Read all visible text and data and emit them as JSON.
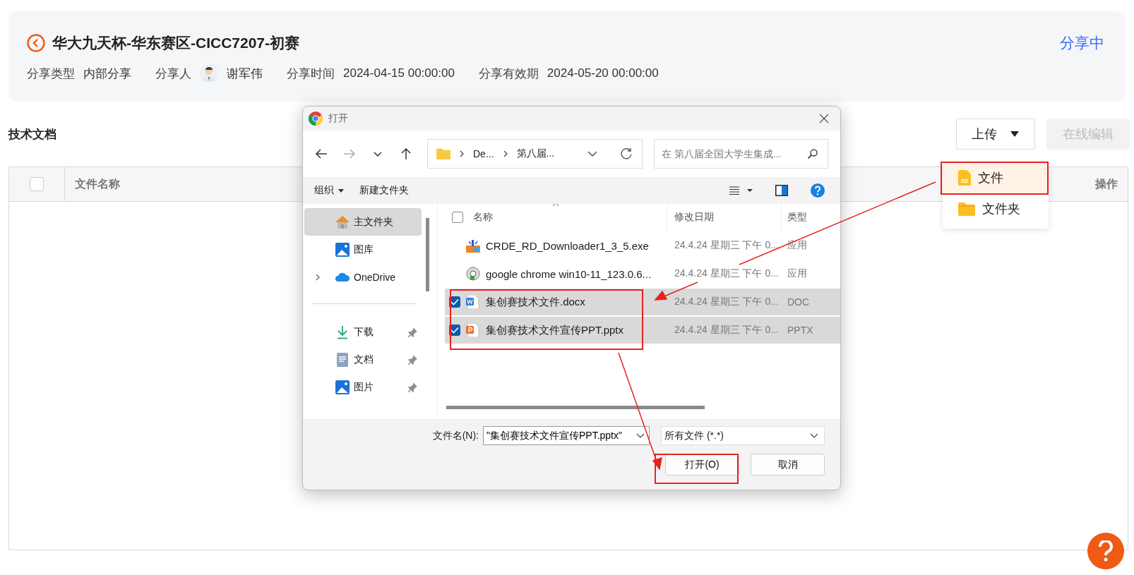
{
  "page": {
    "title": "华大九天杯-华东赛区-CICC7207-初赛",
    "status": "分享中",
    "meta": [
      {
        "label": "分享类型",
        "value": "内部分享",
        "kind": "text"
      },
      {
        "label": "分享人",
        "value": "谢军伟",
        "kind": "person"
      },
      {
        "label": "分享时间",
        "value": "2024-04-15 00:00:00",
        "kind": "text"
      },
      {
        "label": "分享有效期",
        "value": "2024-05-20 00:00:00",
        "kind": "text"
      }
    ]
  },
  "section": {
    "title": "技术文档",
    "upload_button": "上传",
    "edit_button": {
      "label": "在线编辑",
      "disabled": true
    }
  },
  "upload_menu": [
    {
      "label": "文件",
      "kind": "file",
      "selected": true
    },
    {
      "label": "文件夹",
      "kind": "folder",
      "selected": false
    }
  ],
  "table": {
    "columns": [
      "文件名称",
      "操作"
    ],
    "select_all_checked": false
  },
  "dialog": {
    "title": "打开",
    "path": [
      "De...",
      "第八届..."
    ],
    "search_placeholder": "在 第八届全国大学生集成...",
    "toolbar": [
      "组织",
      "新建文件夹"
    ],
    "nav": [
      {
        "label": "主文件夹",
        "kind": "home",
        "selected": true,
        "expandable": false,
        "pinned": false
      },
      {
        "label": "图库",
        "kind": "gallery",
        "selected": false,
        "expandable": false,
        "pinned": false
      },
      {
        "label": "OneDrive",
        "kind": "cloud",
        "selected": false,
        "expandable": true,
        "pinned": false
      },
      {
        "kind": "divider"
      },
      {
        "label": "下载",
        "kind": "download",
        "selected": false,
        "expandable": false,
        "pinned": true
      },
      {
        "label": "文档",
        "kind": "document",
        "selected": false,
        "expandable": false,
        "pinned": true
      },
      {
        "label": "图片",
        "kind": "gallery",
        "selected": false,
        "expandable": false,
        "pinned": true
      }
    ],
    "select_all_checked": false,
    "columns": [
      "名称",
      "修改日期",
      "类型"
    ],
    "files": [
      {
        "name": "CRDE_RD_Downloader1_3_5.exe",
        "date": "24.4.24 星期三 下午 0...",
        "type": "应用",
        "kind": "exe",
        "checked": false
      },
      {
        "name": "google chrome win10-11_123.0.6...",
        "date": "24.4.24 星期三 下午 0...",
        "type": "应用",
        "kind": "setup",
        "checked": false
      },
      {
        "name": "集创赛技术文件.docx",
        "date": "24.4.24 星期三 下午 0...",
        "type": "DOC",
        "kind": "word",
        "checked": true
      },
      {
        "name": "集创赛技术文件宣传PPT.pptx",
        "date": "24.4.24 星期三 下午 0...",
        "type": "PPTX",
        "kind": "ppt",
        "checked": true
      }
    ],
    "filename_label": "文件名(N):",
    "filename": "\"集创赛技术文件宣传PPT.pptx\"",
    "filter": "所有文件 (*.*)",
    "buttons": [
      "打开(O)",
      "取消"
    ]
  }
}
